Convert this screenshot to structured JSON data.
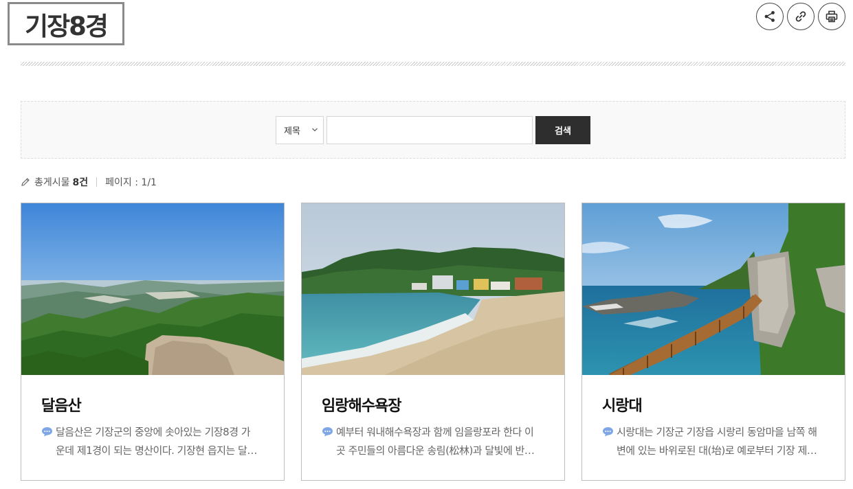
{
  "header": {
    "title": "기장8경"
  },
  "tools": {
    "share_icon": "share-icon",
    "link_icon": "link-icon",
    "print_icon": "print-icon"
  },
  "search": {
    "select_value": "제목",
    "input_value": "",
    "button_label": "검색"
  },
  "meta": {
    "total_label": "총게시물",
    "total_count": "8건",
    "page_label": "페이지 : 1/1"
  },
  "cards": [
    {
      "title": "달음산",
      "desc_line1": "달음산은 기장군의 중앙에 솟아있는 기장8경 가",
      "desc_line2": "운데 제1경이 되는 명산이다. 기장현 읍지는 달…"
    },
    {
      "title": "임랑해수욕장",
      "desc_line1": "예부터 워내해수욕장과 함께 임을랑포라 한다 이",
      "desc_line2": "곳 주민들의 아름다운 송림(松林)과 달빛에 반…"
    },
    {
      "title": "시랑대",
      "desc_line1": "시랑대는 기장군 기장읍 시랑리 동암마을 남쪽 해",
      "desc_line2": "변에 있는 바위로된 대(坮)로 예로부터 기장 제…"
    }
  ],
  "colors": {
    "dark_button": "#2e2e2e",
    "card_border": "#bdbdbd",
    "bubble_icon": "#7fa7e6"
  }
}
